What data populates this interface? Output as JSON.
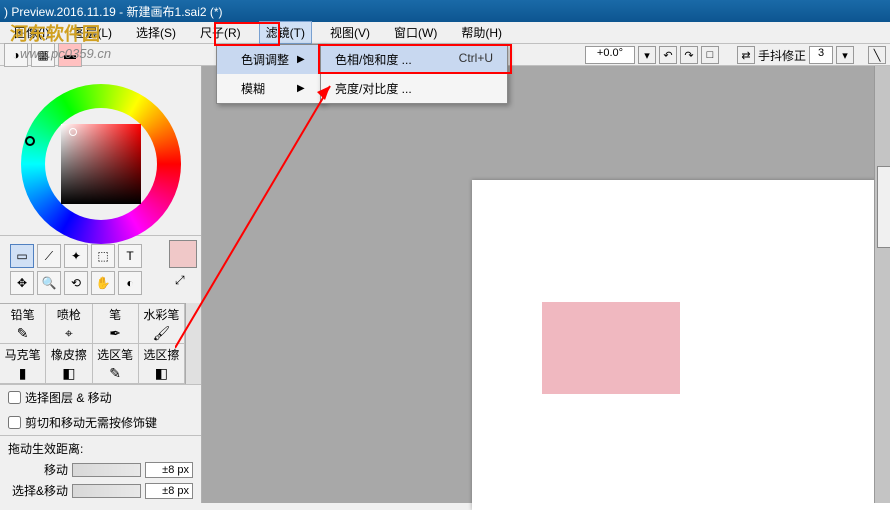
{
  "window": {
    "title": ") Preview.2016.11.19 - 新建画布1.sai2 (*)"
  },
  "watermark": {
    "url": "www.pc0359.cn",
    "logo": "河东软件园"
  },
  "menu": {
    "file": "图像(I)",
    "layer": "图层(L)",
    "select": "选择(S)",
    "ruler": "尺子(R)",
    "filter": "滤镜(T)",
    "view": "视图(V)",
    "window": "窗口(W)",
    "help": "帮助(H)"
  },
  "submenu": {
    "color_adjust": "色调调整",
    "blur": "模糊"
  },
  "submenu2": {
    "hue_sat": "色相/饱和度 ...",
    "hue_sat_key": "Ctrl+U",
    "bright_con": "亮度/对比度 ..."
  },
  "toolbar_right": {
    "angle": "+0.0°",
    "stabilizer_label": "手抖修正",
    "stabilizer_value": "3"
  },
  "tools": {
    "rect_select": "▭",
    "lasso": "⟋",
    "wand": "✦",
    "move_sel": "⬚",
    "text": "T",
    "move": "✥",
    "zoom": "🔍",
    "rotate": "⟲",
    "hand": "✋",
    "eyedrop": "◐"
  },
  "brushes": {
    "b1": "铅笔",
    "b2": "喷枪",
    "b3": "笔",
    "b4": "水彩笔",
    "b5": "马克笔",
    "b6": "橡皮擦",
    "b7": "选区笔",
    "b8": "选区擦"
  },
  "options": {
    "opt1": "选择图层 & 移动",
    "opt2": "剪切和移动无需按修饰键",
    "effect_label": "拖动生效距离:",
    "move_label": "移动",
    "move_val": "±8 px",
    "selmove_label": "选择&移动",
    "selmove_val": "±8 px"
  }
}
